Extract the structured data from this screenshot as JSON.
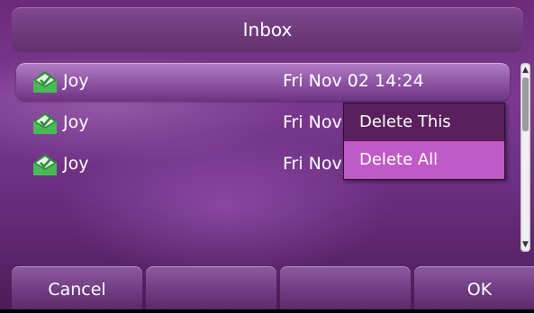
{
  "title": "Inbox",
  "messages": [
    {
      "sender": "Joy",
      "date": "Fri Nov 02 14:24",
      "icon": "envelope-check-icon"
    },
    {
      "sender": "Joy",
      "date": "Fri Nov",
      "icon": "envelope-check-icon"
    },
    {
      "sender": "Joy",
      "date": "Fri Nov",
      "icon": "envelope-check-icon"
    }
  ],
  "context_menu": {
    "items": [
      "Delete This",
      "Delete All"
    ]
  },
  "softkeys": [
    "Cancel",
    "",
    "",
    "OK"
  ],
  "colors": {
    "background": "#6d2f82",
    "highlight": "#c05ac6",
    "menu_selected_dark": "#5a1f5c"
  }
}
